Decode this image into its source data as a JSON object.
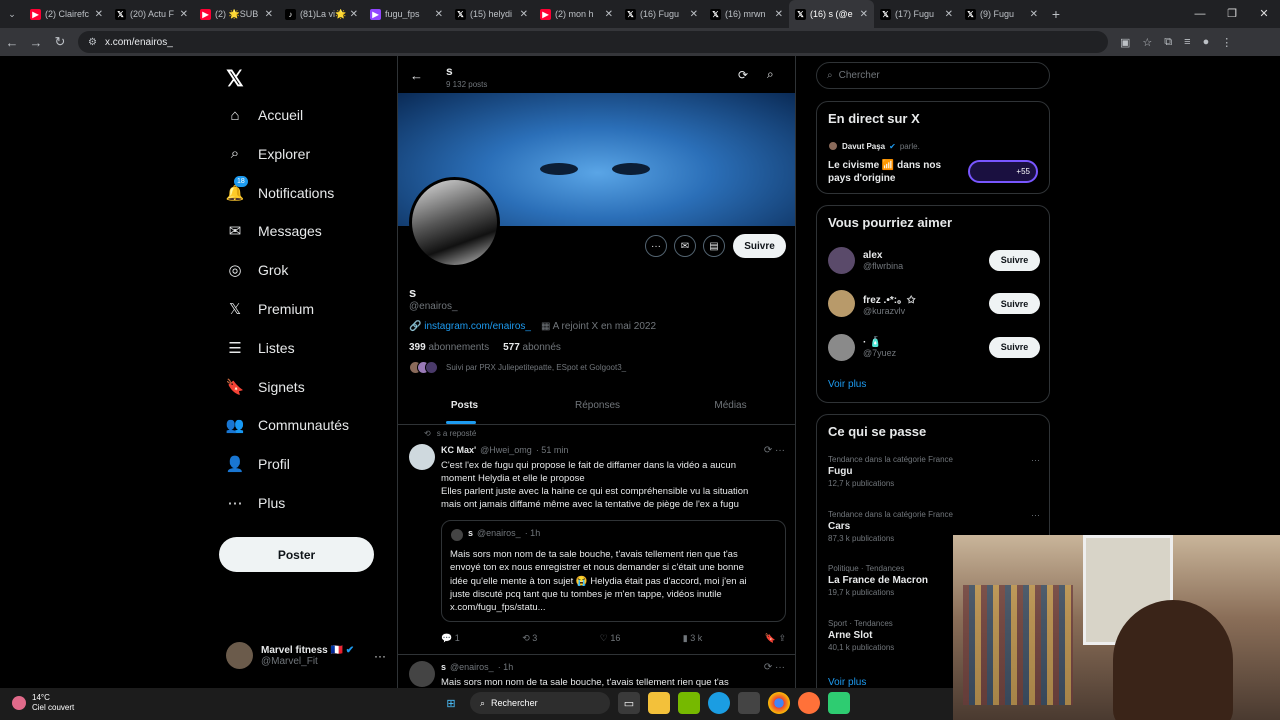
{
  "browser": {
    "tabs": [
      {
        "title": "(2) Clairefc",
        "icon": "youtube-icon",
        "color": "#ff0033"
      },
      {
        "title": "(20) Actu F",
        "icon": "x-icon",
        "color": "#000000"
      },
      {
        "title": "(2) 🌟SUB",
        "icon": "youtube-icon",
        "color": "#ff0033"
      },
      {
        "title": "(81)La vi🌟",
        "icon": "tiktok-icon",
        "color": "#000000"
      },
      {
        "title": "fugu_fps",
        "icon": "twitch-icon",
        "color": "#9146ff"
      },
      {
        "title": "(15) helydi",
        "icon": "x-icon",
        "color": "#000000"
      },
      {
        "title": "(2) mon h",
        "icon": "youtube-icon",
        "color": "#ff0033"
      },
      {
        "title": "(16) Fugu",
        "icon": "x-icon",
        "color": "#000000"
      },
      {
        "title": "(16) mrwn",
        "icon": "x-icon",
        "color": "#000000"
      },
      {
        "title": "(16) s (@e",
        "icon": "x-icon",
        "color": "#000000",
        "active": true
      },
      {
        "title": "(17) Fugu",
        "icon": "x-icon",
        "color": "#000000"
      },
      {
        "title": "(9) Fugu",
        "icon": "x-icon",
        "color": "#000000"
      }
    ],
    "url": "x.com/enairos_"
  },
  "nav": {
    "items": [
      {
        "label": "Accueil",
        "icon": "home-icon"
      },
      {
        "label": "Explorer",
        "icon": "search-icon"
      },
      {
        "label": "Notifications",
        "icon": "bell-icon",
        "badge": "18"
      },
      {
        "label": "Messages",
        "icon": "mail-icon"
      },
      {
        "label": "Grok",
        "icon": "grok-icon"
      },
      {
        "label": "Premium",
        "icon": "x-logo-icon"
      },
      {
        "label": "Listes",
        "icon": "list-icon"
      },
      {
        "label": "Signets",
        "icon": "bookmark-icon"
      },
      {
        "label": "Communautés",
        "icon": "people-icon"
      },
      {
        "label": "Profil",
        "icon": "person-icon"
      },
      {
        "label": "Plus",
        "icon": "more-circle-icon"
      }
    ],
    "post_label": "Poster",
    "account": {
      "name": "Marvel fitness 🇫🇷",
      "handle": "@Marvel_Fit"
    }
  },
  "profile": {
    "name": "s",
    "posts_count": "9 132 posts",
    "handle": "@enairos_",
    "link": "instagram.com/enairos_",
    "joined": "A rejoint X en mai 2022",
    "following_count": "399",
    "following_label": "abonnements",
    "followers_count": "577",
    "followers_label": "abonnés",
    "followed_by": "Suivi par PRX Juliepetitepatte, ESpot et Golgoot3_",
    "follow_label": "Suivre",
    "tabs": [
      "Posts",
      "Réponses",
      "Médias"
    ]
  },
  "tweets": [
    {
      "repost_label": "s a reposté",
      "name": "KC Max'",
      "handle": "@Hwei_omg",
      "time": "· 51 min",
      "text_lines": [
        "C'est l'ex de fugu qui propose le fait de diffamer dans la vidéo a aucun",
        "moment Helydia et elle le propose",
        "Elles parlent juste avec la haine ce qui est compréhensible vu la situation",
        "mais ont jamais diffamé même avec la tentative de piège de l'ex a fugu"
      ],
      "quote": {
        "name": "s",
        "handle": "@enairos_",
        "time": "· 1h",
        "text_lines": [
          "Mais sors mon nom de ta sale bouche, t'avais tellement rien que t'as",
          "envoyé ton ex nous enregistrer et nous demander si c'était une bonne",
          "idée qu'elle mente à ton sujet 😭 Helydia était pas d'accord, moi j'en ai",
          "juste discuté pcq tant que tu tombes je m'en tappe, vidéos inutile",
          "x.com/fugu_fps/statu..."
        ]
      },
      "replies": "1",
      "reposts": "3",
      "likes": "16",
      "views": "3 k"
    },
    {
      "name": "s",
      "handle": "@enairos_",
      "time": "· 1h",
      "text_lines": [
        "Mais sors mon nom de ta sale bouche, t'avais tellement rien que t'as"
      ]
    }
  ],
  "right": {
    "search_placeholder": "Chercher",
    "live": {
      "title": "En direct sur X",
      "host": "Davut Paşa",
      "host_status": "parle.",
      "topic_line1": "Le civisme 📶 dans nos",
      "topic_line2": "pays d'origine",
      "listeners": "+55"
    },
    "suggestions": {
      "title": "Vous pourriez aimer",
      "people": [
        {
          "name": "alex",
          "handle": "@flwrbina"
        },
        {
          "name": "frez .•*:。✩",
          "handle": "@kurazvlv"
        },
        {
          "name": "· 🧴",
          "handle": "@7yuez"
        }
      ],
      "follow_label": "Suivre",
      "more_label": "Voir plus"
    },
    "trends": {
      "title": "Ce qui se passe",
      "items": [
        {
          "context": "Tendance dans la catégorie France",
          "name": "Fugu",
          "posts": "12,7 k publications"
        },
        {
          "context": "Tendance dans la catégorie France",
          "name": "Cars",
          "posts": "87,3 k publications"
        },
        {
          "context": "Politique · Tendances",
          "name": "La France de Macron",
          "posts": "19,7 k publications"
        },
        {
          "context": "Sport · Tendances",
          "name": "Arne Slot",
          "posts": "40,1 k publications"
        }
      ],
      "more_label": "Voir plus"
    }
  },
  "taskbar": {
    "temp": "14°C",
    "condition": "Ciel couvert",
    "search_label": "Rechercher"
  }
}
